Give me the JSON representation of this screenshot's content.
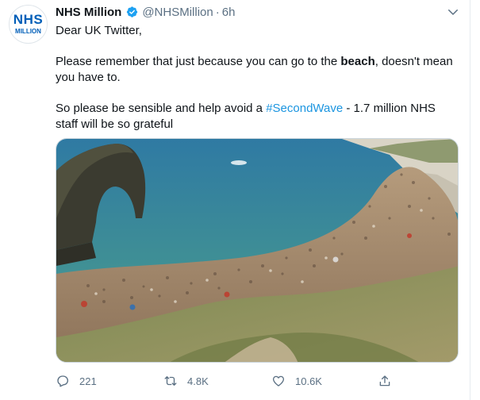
{
  "tweet": {
    "display_name": "NHS Million",
    "handle": "@NHSMillion",
    "separator": "·",
    "time": "6h",
    "verified_icon": "verified-badge-icon",
    "avatar": {
      "line1": "NHS",
      "line2": "MILLION",
      "color": "#005eb8"
    },
    "text": {
      "greeting": "Dear UK Twitter,",
      "p2_before": "Please remember that just because you can go to the ",
      "p2_bold": "beach",
      "p2_after": ", doesn't mean you have to.",
      "p3_before": "So please be sensible and help avoid a ",
      "p3_hashtag": "#SecondWave",
      "p3_after": " - 1.7 million NHS staff will be so grateful"
    },
    "media_description_icon": "beach-photo",
    "actions": {
      "reply_count": "221",
      "retweet_count": "4.8K",
      "like_count": "10.6K"
    }
  },
  "colors": {
    "hashtag": "#1b95e0",
    "muted": "#5b7083",
    "verified": "#1da1f2"
  }
}
